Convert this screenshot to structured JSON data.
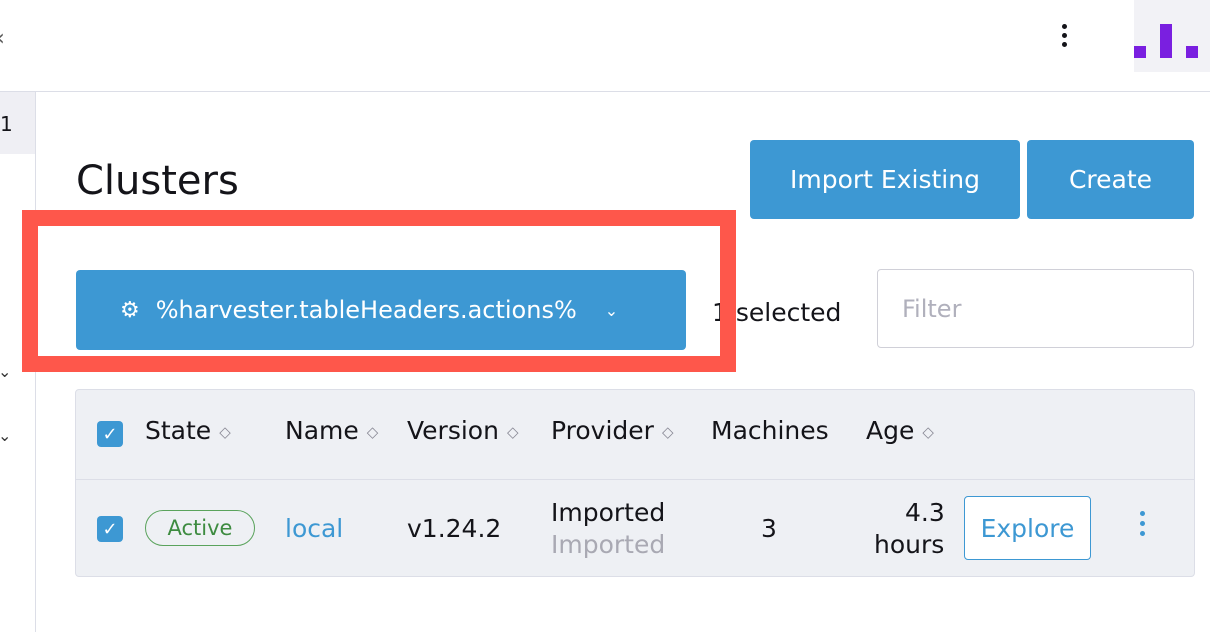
{
  "header": {
    "menu_icon": "vertical-ellipsis-icon",
    "brand_icon": "rancher-bars-logo",
    "brand_color": "#7a1fe0"
  },
  "sidebar": {
    "number": "1"
  },
  "page": {
    "title": "Clusters",
    "import_label": "Import Existing",
    "create_label": "Create"
  },
  "bulk": {
    "actions_label": "%harvester.tableHeaders.actions%",
    "actions_icon": "gear-icon",
    "selected_text": "1 selected",
    "filter_placeholder": "Filter"
  },
  "table": {
    "columns": [
      "State",
      "Name",
      "Version",
      "Provider",
      "Machines",
      "Age"
    ],
    "rows": [
      {
        "state": "Active",
        "name": "local",
        "version": "v1.24.2",
        "provider": "Imported",
        "provider_sub": "Imported",
        "machines": "3",
        "age_line1": "4.3",
        "age_line2": "hours",
        "action_label": "Explore"
      }
    ]
  },
  "colors": {
    "accent": "#3d98d3",
    "highlight": "#fe574b",
    "active": "#5aa35c"
  }
}
